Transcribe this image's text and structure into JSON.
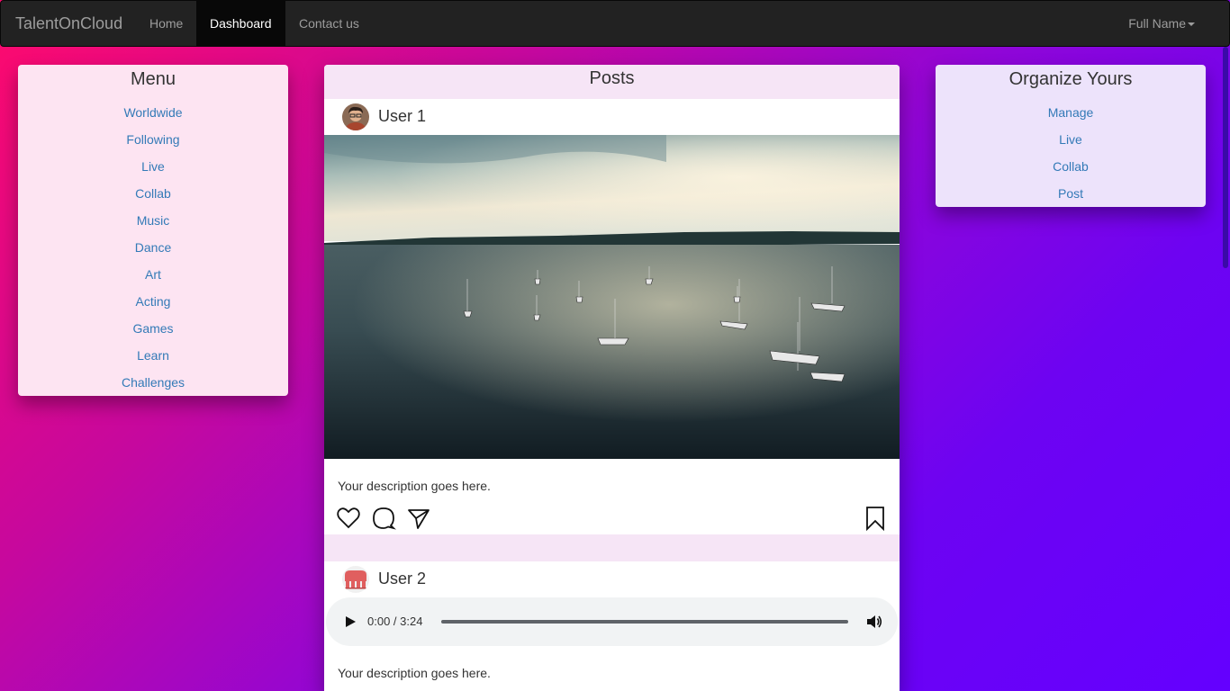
{
  "navbar": {
    "brand": "TalentOnCloud",
    "links": [
      "Home",
      "Dashboard",
      "Contact us"
    ],
    "active": "Dashboard",
    "user": "Full Name"
  },
  "menu": {
    "title": "Menu",
    "items": [
      "Worldwide",
      "Following",
      "Live",
      "Collab",
      "Music",
      "Dance",
      "Art",
      "Acting",
      "Games",
      "Learn",
      "Challenges"
    ]
  },
  "organize": {
    "title": "Organize Yours",
    "items": [
      "Manage",
      "Live",
      "Collab",
      "Post"
    ]
  },
  "posts": {
    "title": "Posts",
    "post1": {
      "user": "User 1",
      "description": "Your description goes here.",
      "actions": [
        "heart-icon",
        "comment-icon",
        "share-icon",
        "bookmark-icon"
      ]
    },
    "post2": {
      "user": "User 2",
      "audio_time": "0:00 / 3:24",
      "description": "Your description goes here."
    }
  },
  "colors": {
    "navbar": "#222222",
    "link": "#337ab7",
    "menu_bg": "#fde4f2",
    "organize_bg": "#ede3fb",
    "gradient_start": "#ff0a6c",
    "gradient_end": "#6400ff"
  }
}
